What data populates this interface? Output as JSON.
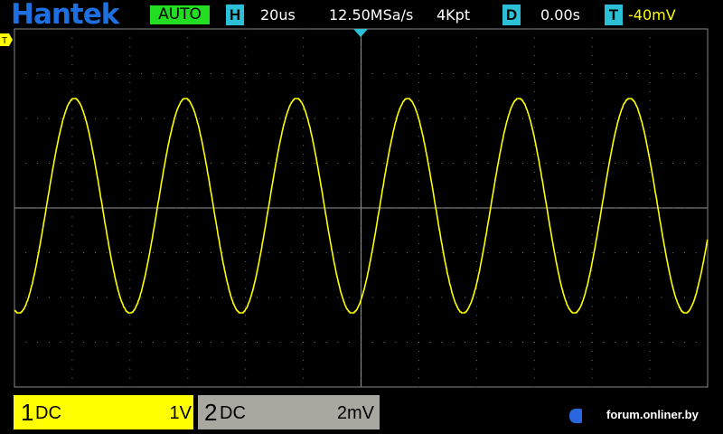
{
  "header": {
    "logo": "Hantek",
    "mode": "AUTO",
    "h_label": "H",
    "timebase": "20us",
    "sample_rate": "12.50MSa/s",
    "memory_depth": "4Kpt",
    "d_label": "D",
    "delay": "0.00s",
    "t_label": "T",
    "trigger_level": "-40mV"
  },
  "trigger_marker": "T",
  "channels": [
    {
      "number": "1",
      "coupling": "DC",
      "scale": "1V",
      "color": "#ffff00"
    },
    {
      "number": "2",
      "coupling": "DC",
      "scale": "2mV",
      "color": "#a8a8a0"
    }
  ],
  "watermark": "forum.onliner.by",
  "colors": {
    "trace": "#ffff00",
    "accent": "#2bc0d6",
    "logo": "#1e6fe0",
    "auto": "#22dd22"
  },
  "chart_data": {
    "type": "line",
    "xlabel": "",
    "ylabel": "",
    "x_unit": "us",
    "y_unit": "V",
    "x_range": [
      -120,
      120
    ],
    "y_range": [
      -4,
      4
    ],
    "grid": true,
    "series": [
      {
        "waveform": "sine",
        "frequency_khz": 26,
        "amplitude_v": 2.4,
        "offset_v": 0.05,
        "trough_time_us": -3.1
      }
    ]
  }
}
